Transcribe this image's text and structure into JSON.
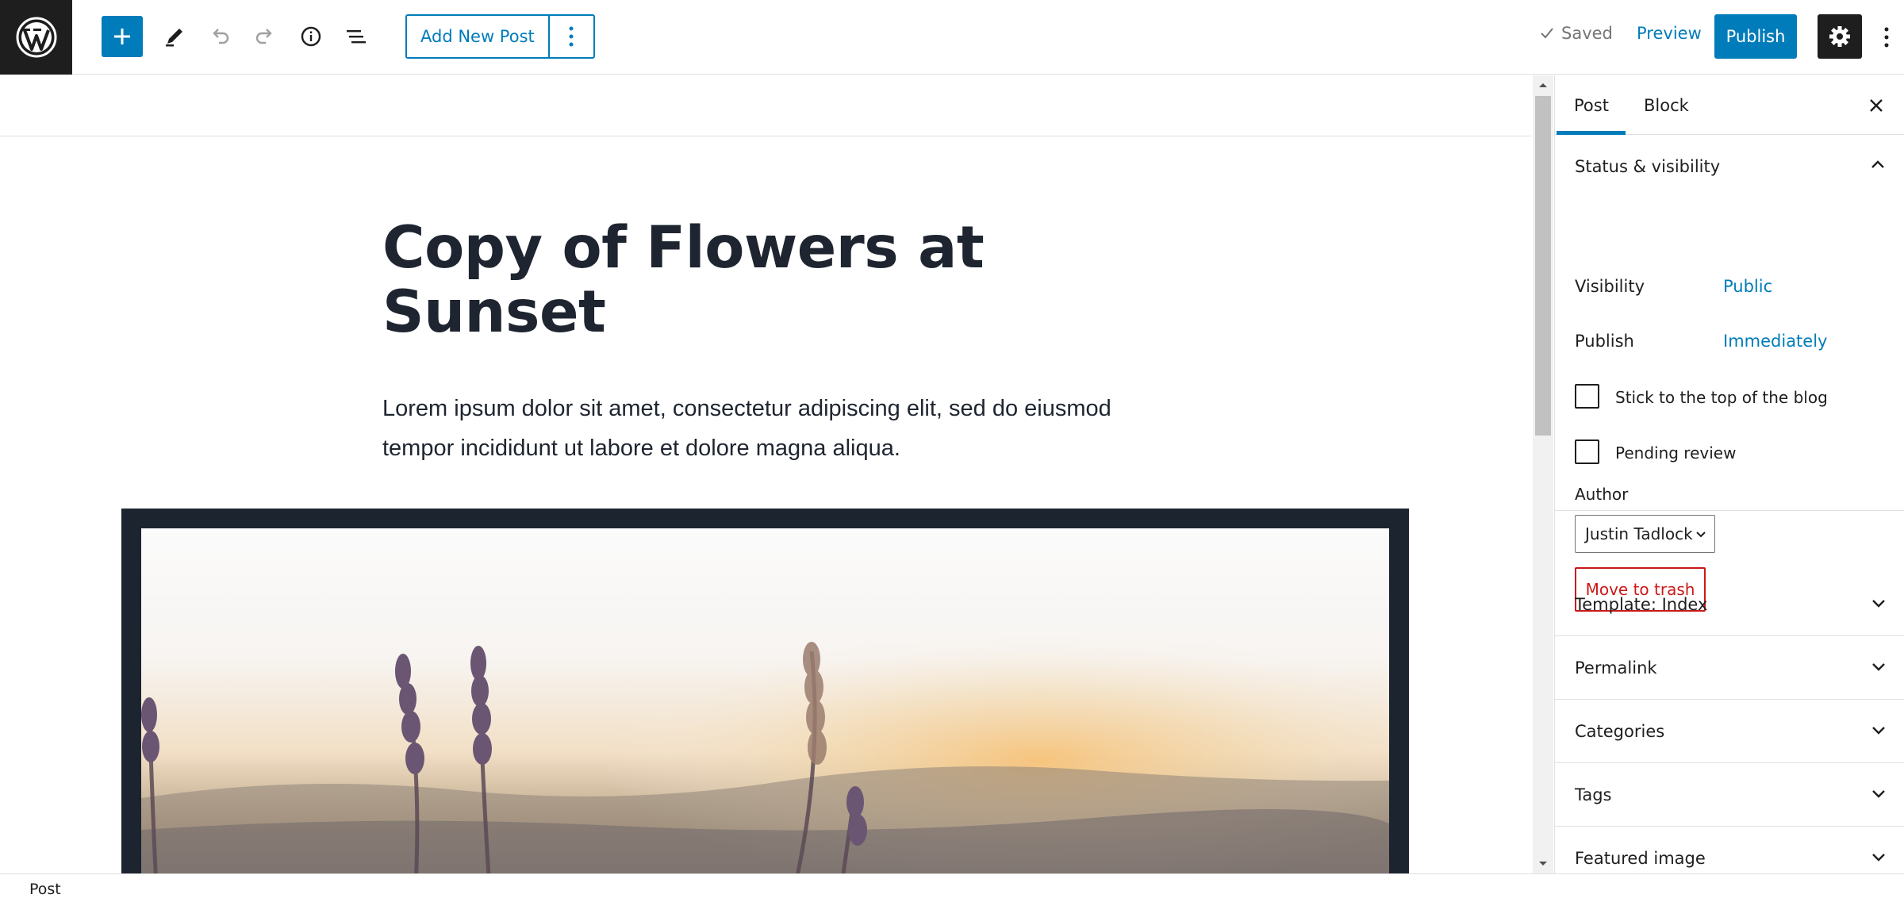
{
  "toolbar": {
    "logo_icon": "wordpress-logo",
    "add_new_post_label": "Add New Post",
    "saved_label": "Saved",
    "preview_label": "Preview",
    "publish_label": "Publish",
    "accent_color": "#007cba"
  },
  "post": {
    "title": "Copy of Flowers at Sunset",
    "paragraph": "Lorem ipsum dolor sit amet, consectetur adipiscing elit, sed do eiusmod tempor incididunt ut labore et dolore magna aliqua.",
    "image_frame_color": "#1c2430"
  },
  "sidebar": {
    "tabs": [
      {
        "label": "Post",
        "active": true
      },
      {
        "label": "Block",
        "active": false
      }
    ],
    "status_visibility": {
      "title": "Status & visibility",
      "visibility_label": "Visibility",
      "visibility_value": "Public",
      "publish_label": "Publish",
      "publish_value": "Immediately",
      "sticky_label": "Stick to the top of the blog",
      "pending_label": "Pending review",
      "author_label": "Author",
      "author_value": "Justin Tadlock",
      "trash_label": "Move to trash"
    },
    "panels": [
      {
        "title": "Template: Index"
      },
      {
        "title": "Permalink"
      },
      {
        "title": "Categories"
      },
      {
        "title": "Tags"
      },
      {
        "title": "Featured image"
      }
    ]
  },
  "footer": {
    "breadcrumb": "Post"
  }
}
